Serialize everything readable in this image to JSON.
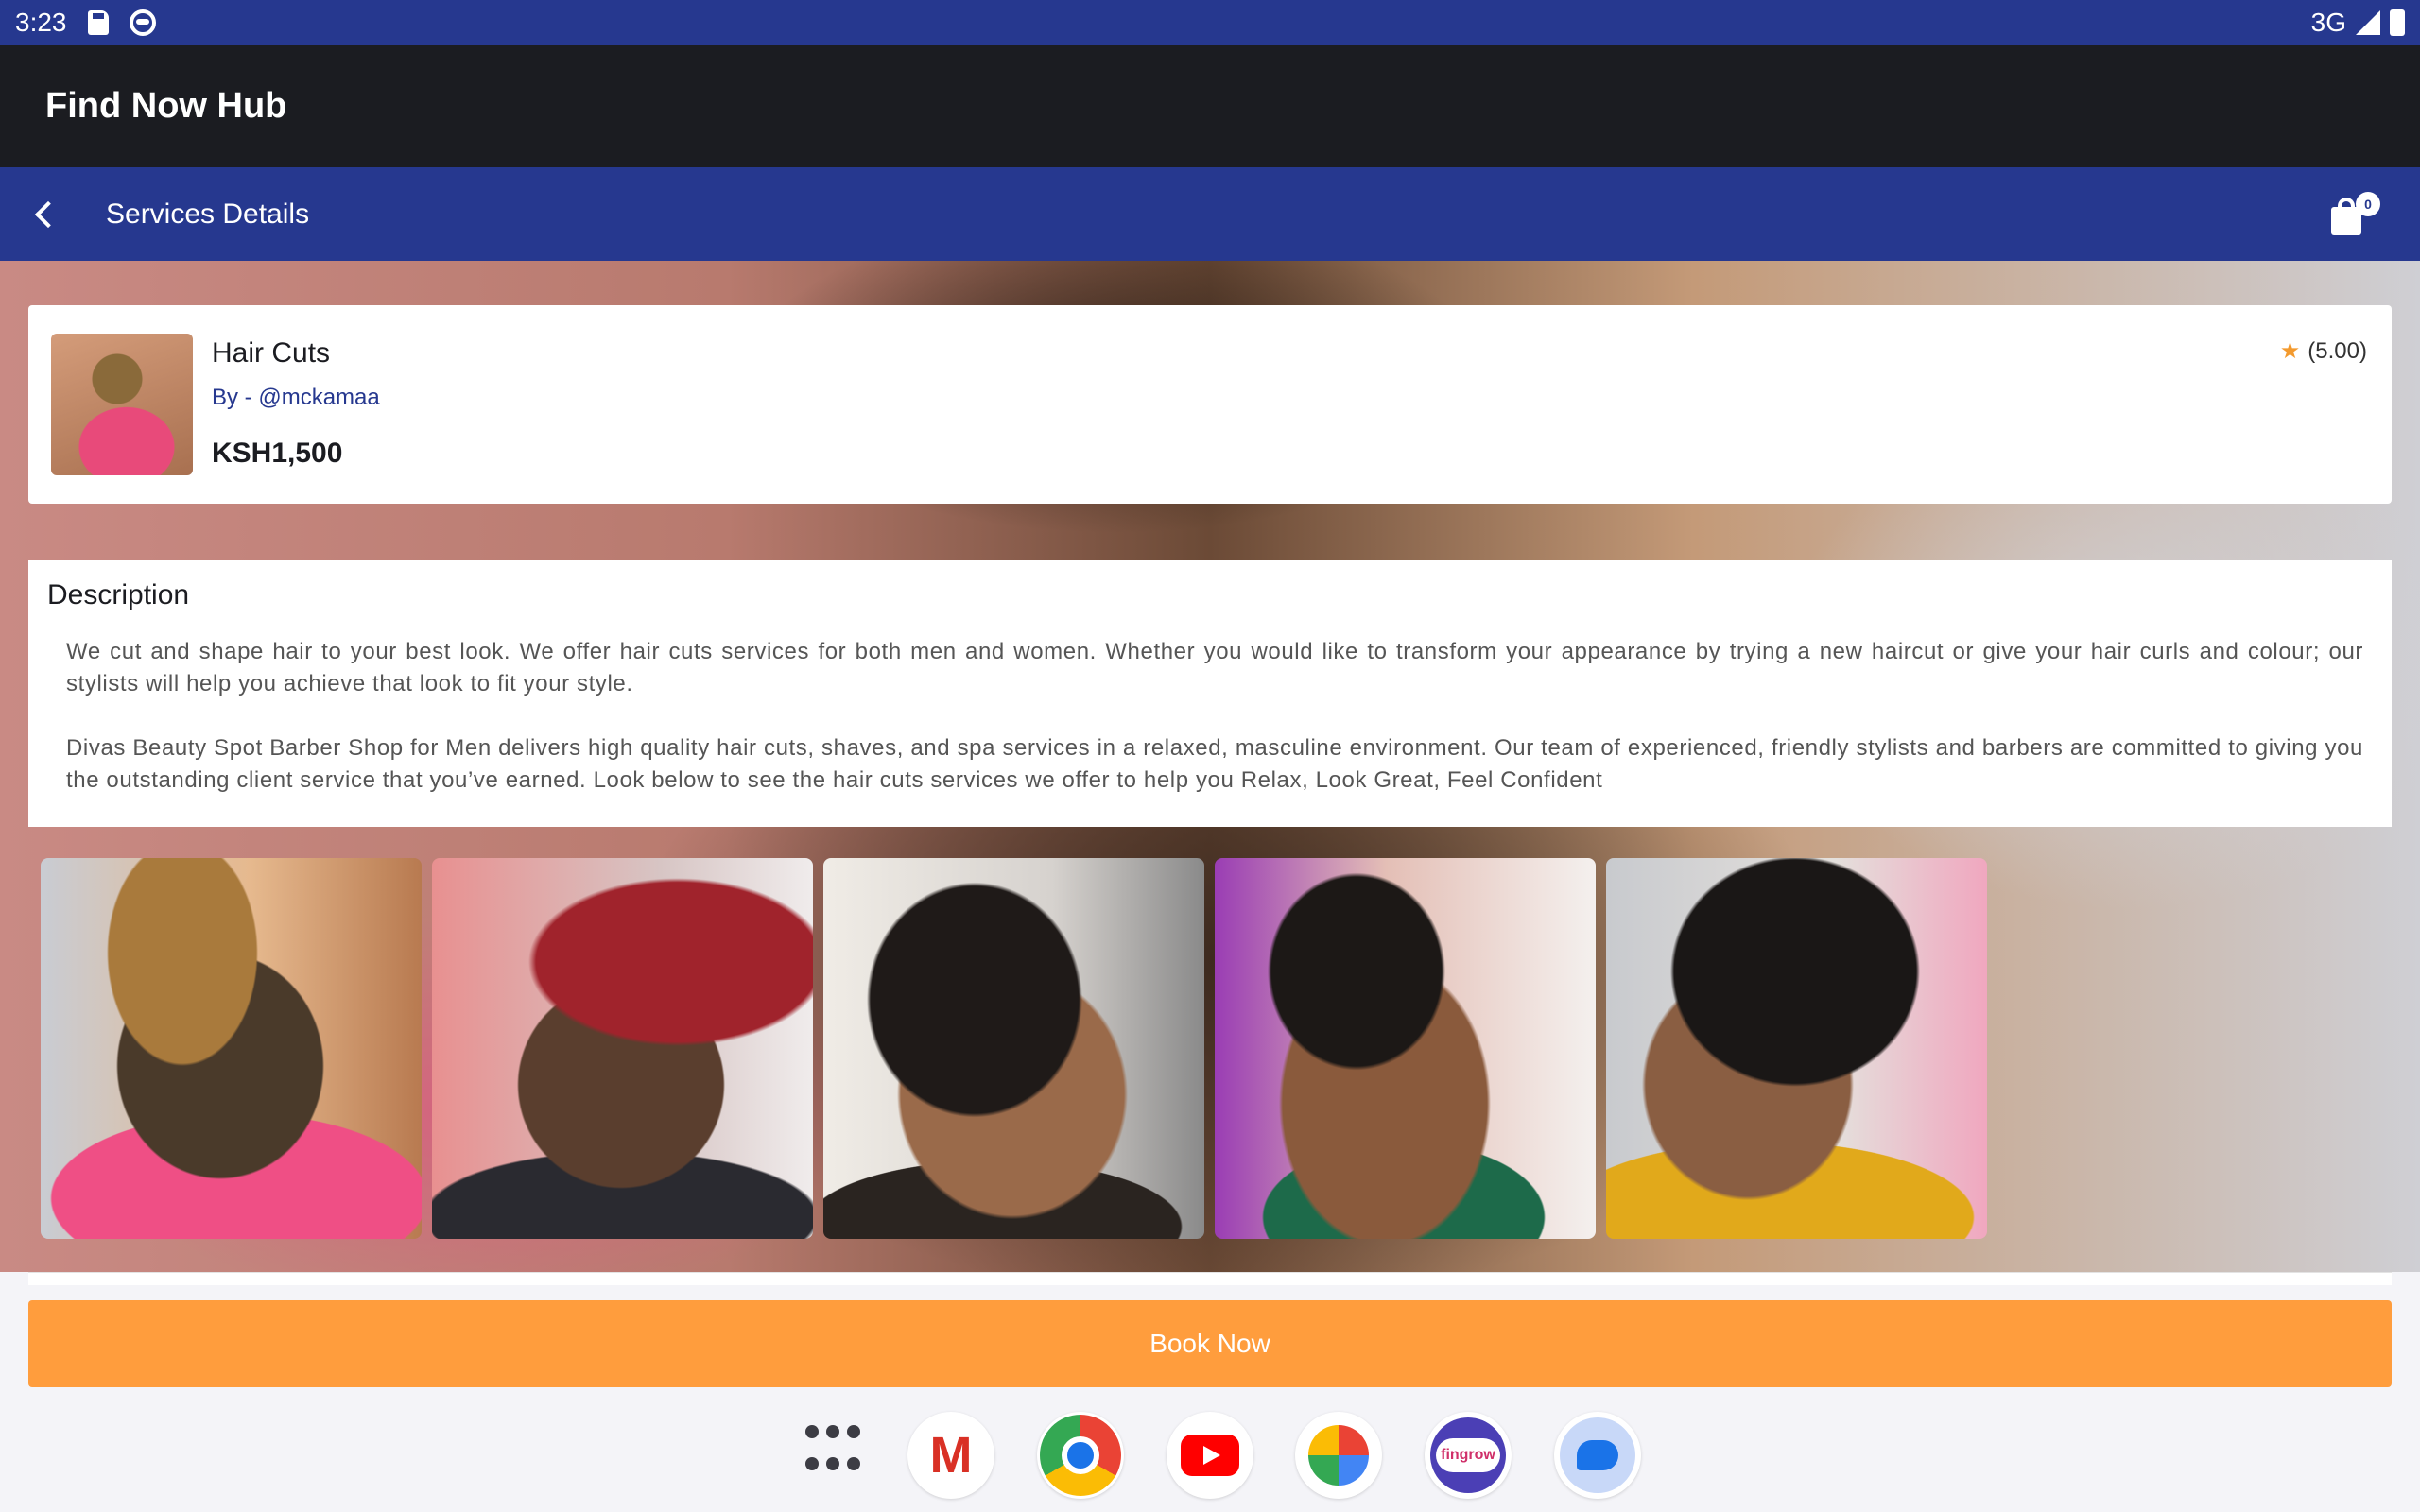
{
  "status_bar": {
    "time": "3:23",
    "network": "3G",
    "icons": [
      "sd-card-icon",
      "face-icon",
      "signal-icon",
      "battery-icon"
    ]
  },
  "app": {
    "title": "Find Now Hub"
  },
  "nav": {
    "title": "Services Details",
    "back_icon": "chevron-left-icon",
    "cart_icon": "shopping-bag-icon",
    "cart_count": "0"
  },
  "service": {
    "title": "Hair Cuts",
    "by": "By - @mckamaa",
    "price": "KSH1,500",
    "rating": "(5.00)",
    "rating_icon": "star-icon"
  },
  "description": {
    "heading": "Description",
    "paragraphs": [
      "We cut and shape hair to your best look. We offer hair cuts services for both men and women. Whether you would like to transform your appearance by trying a new haircut or give your hair curls and colour; our stylists will help you achieve that look to fit your style.",
      "Divas Beauty Spot Barber Shop for Men delivers high quality hair cuts, shaves, and spa services in a relaxed, masculine environment. Our team of experienced, friendly stylists and barbers are committed to giving you the outstanding client service that you’ve earned. Look below to see the hair cuts services we offer to help you Relax, Look Great, Feel Confident"
    ]
  },
  "gallery": {
    "count": 5
  },
  "actions": {
    "book_now": "Book Now"
  },
  "dock": {
    "apps": [
      "app-drawer",
      "Gmail",
      "Chrome",
      "YouTube",
      "Photos",
      "fingrow",
      "Messages"
    ],
    "fingrow_label": "fingrow"
  },
  "colors": {
    "primary": "#26388f",
    "title_bar": "#1b1c21",
    "accent": "#ff9d3d",
    "star": "#f39a2e"
  }
}
